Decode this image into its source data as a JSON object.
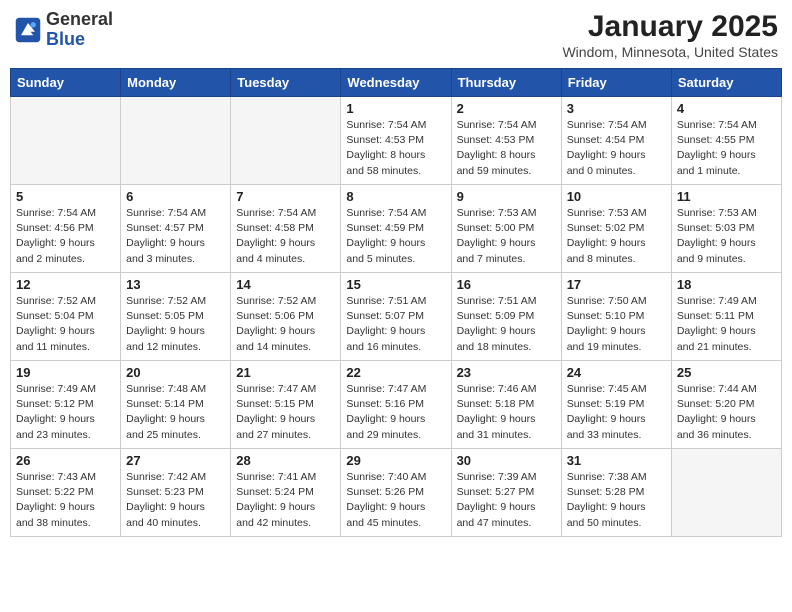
{
  "header": {
    "logo_general": "General",
    "logo_blue": "Blue",
    "month_title": "January 2025",
    "location": "Windom, Minnesota, United States"
  },
  "days_of_week": [
    "Sunday",
    "Monday",
    "Tuesday",
    "Wednesday",
    "Thursday",
    "Friday",
    "Saturday"
  ],
  "weeks": [
    [
      {
        "day": "",
        "info": ""
      },
      {
        "day": "",
        "info": ""
      },
      {
        "day": "",
        "info": ""
      },
      {
        "day": "1",
        "info": "Sunrise: 7:54 AM\nSunset: 4:53 PM\nDaylight: 8 hours\nand 58 minutes."
      },
      {
        "day": "2",
        "info": "Sunrise: 7:54 AM\nSunset: 4:53 PM\nDaylight: 8 hours\nand 59 minutes."
      },
      {
        "day": "3",
        "info": "Sunrise: 7:54 AM\nSunset: 4:54 PM\nDaylight: 9 hours\nand 0 minutes."
      },
      {
        "day": "4",
        "info": "Sunrise: 7:54 AM\nSunset: 4:55 PM\nDaylight: 9 hours\nand 1 minute."
      }
    ],
    [
      {
        "day": "5",
        "info": "Sunrise: 7:54 AM\nSunset: 4:56 PM\nDaylight: 9 hours\nand 2 minutes."
      },
      {
        "day": "6",
        "info": "Sunrise: 7:54 AM\nSunset: 4:57 PM\nDaylight: 9 hours\nand 3 minutes."
      },
      {
        "day": "7",
        "info": "Sunrise: 7:54 AM\nSunset: 4:58 PM\nDaylight: 9 hours\nand 4 minutes."
      },
      {
        "day": "8",
        "info": "Sunrise: 7:54 AM\nSunset: 4:59 PM\nDaylight: 9 hours\nand 5 minutes."
      },
      {
        "day": "9",
        "info": "Sunrise: 7:53 AM\nSunset: 5:00 PM\nDaylight: 9 hours\nand 7 minutes."
      },
      {
        "day": "10",
        "info": "Sunrise: 7:53 AM\nSunset: 5:02 PM\nDaylight: 9 hours\nand 8 minutes."
      },
      {
        "day": "11",
        "info": "Sunrise: 7:53 AM\nSunset: 5:03 PM\nDaylight: 9 hours\nand 9 minutes."
      }
    ],
    [
      {
        "day": "12",
        "info": "Sunrise: 7:52 AM\nSunset: 5:04 PM\nDaylight: 9 hours\nand 11 minutes."
      },
      {
        "day": "13",
        "info": "Sunrise: 7:52 AM\nSunset: 5:05 PM\nDaylight: 9 hours\nand 12 minutes."
      },
      {
        "day": "14",
        "info": "Sunrise: 7:52 AM\nSunset: 5:06 PM\nDaylight: 9 hours\nand 14 minutes."
      },
      {
        "day": "15",
        "info": "Sunrise: 7:51 AM\nSunset: 5:07 PM\nDaylight: 9 hours\nand 16 minutes."
      },
      {
        "day": "16",
        "info": "Sunrise: 7:51 AM\nSunset: 5:09 PM\nDaylight: 9 hours\nand 18 minutes."
      },
      {
        "day": "17",
        "info": "Sunrise: 7:50 AM\nSunset: 5:10 PM\nDaylight: 9 hours\nand 19 minutes."
      },
      {
        "day": "18",
        "info": "Sunrise: 7:49 AM\nSunset: 5:11 PM\nDaylight: 9 hours\nand 21 minutes."
      }
    ],
    [
      {
        "day": "19",
        "info": "Sunrise: 7:49 AM\nSunset: 5:12 PM\nDaylight: 9 hours\nand 23 minutes."
      },
      {
        "day": "20",
        "info": "Sunrise: 7:48 AM\nSunset: 5:14 PM\nDaylight: 9 hours\nand 25 minutes."
      },
      {
        "day": "21",
        "info": "Sunrise: 7:47 AM\nSunset: 5:15 PM\nDaylight: 9 hours\nand 27 minutes."
      },
      {
        "day": "22",
        "info": "Sunrise: 7:47 AM\nSunset: 5:16 PM\nDaylight: 9 hours\nand 29 minutes."
      },
      {
        "day": "23",
        "info": "Sunrise: 7:46 AM\nSunset: 5:18 PM\nDaylight: 9 hours\nand 31 minutes."
      },
      {
        "day": "24",
        "info": "Sunrise: 7:45 AM\nSunset: 5:19 PM\nDaylight: 9 hours\nand 33 minutes."
      },
      {
        "day": "25",
        "info": "Sunrise: 7:44 AM\nSunset: 5:20 PM\nDaylight: 9 hours\nand 36 minutes."
      }
    ],
    [
      {
        "day": "26",
        "info": "Sunrise: 7:43 AM\nSunset: 5:22 PM\nDaylight: 9 hours\nand 38 minutes."
      },
      {
        "day": "27",
        "info": "Sunrise: 7:42 AM\nSunset: 5:23 PM\nDaylight: 9 hours\nand 40 minutes."
      },
      {
        "day": "28",
        "info": "Sunrise: 7:41 AM\nSunset: 5:24 PM\nDaylight: 9 hours\nand 42 minutes."
      },
      {
        "day": "29",
        "info": "Sunrise: 7:40 AM\nSunset: 5:26 PM\nDaylight: 9 hours\nand 45 minutes."
      },
      {
        "day": "30",
        "info": "Sunrise: 7:39 AM\nSunset: 5:27 PM\nDaylight: 9 hours\nand 47 minutes."
      },
      {
        "day": "31",
        "info": "Sunrise: 7:38 AM\nSunset: 5:28 PM\nDaylight: 9 hours\nand 50 minutes."
      },
      {
        "day": "",
        "info": ""
      }
    ]
  ]
}
